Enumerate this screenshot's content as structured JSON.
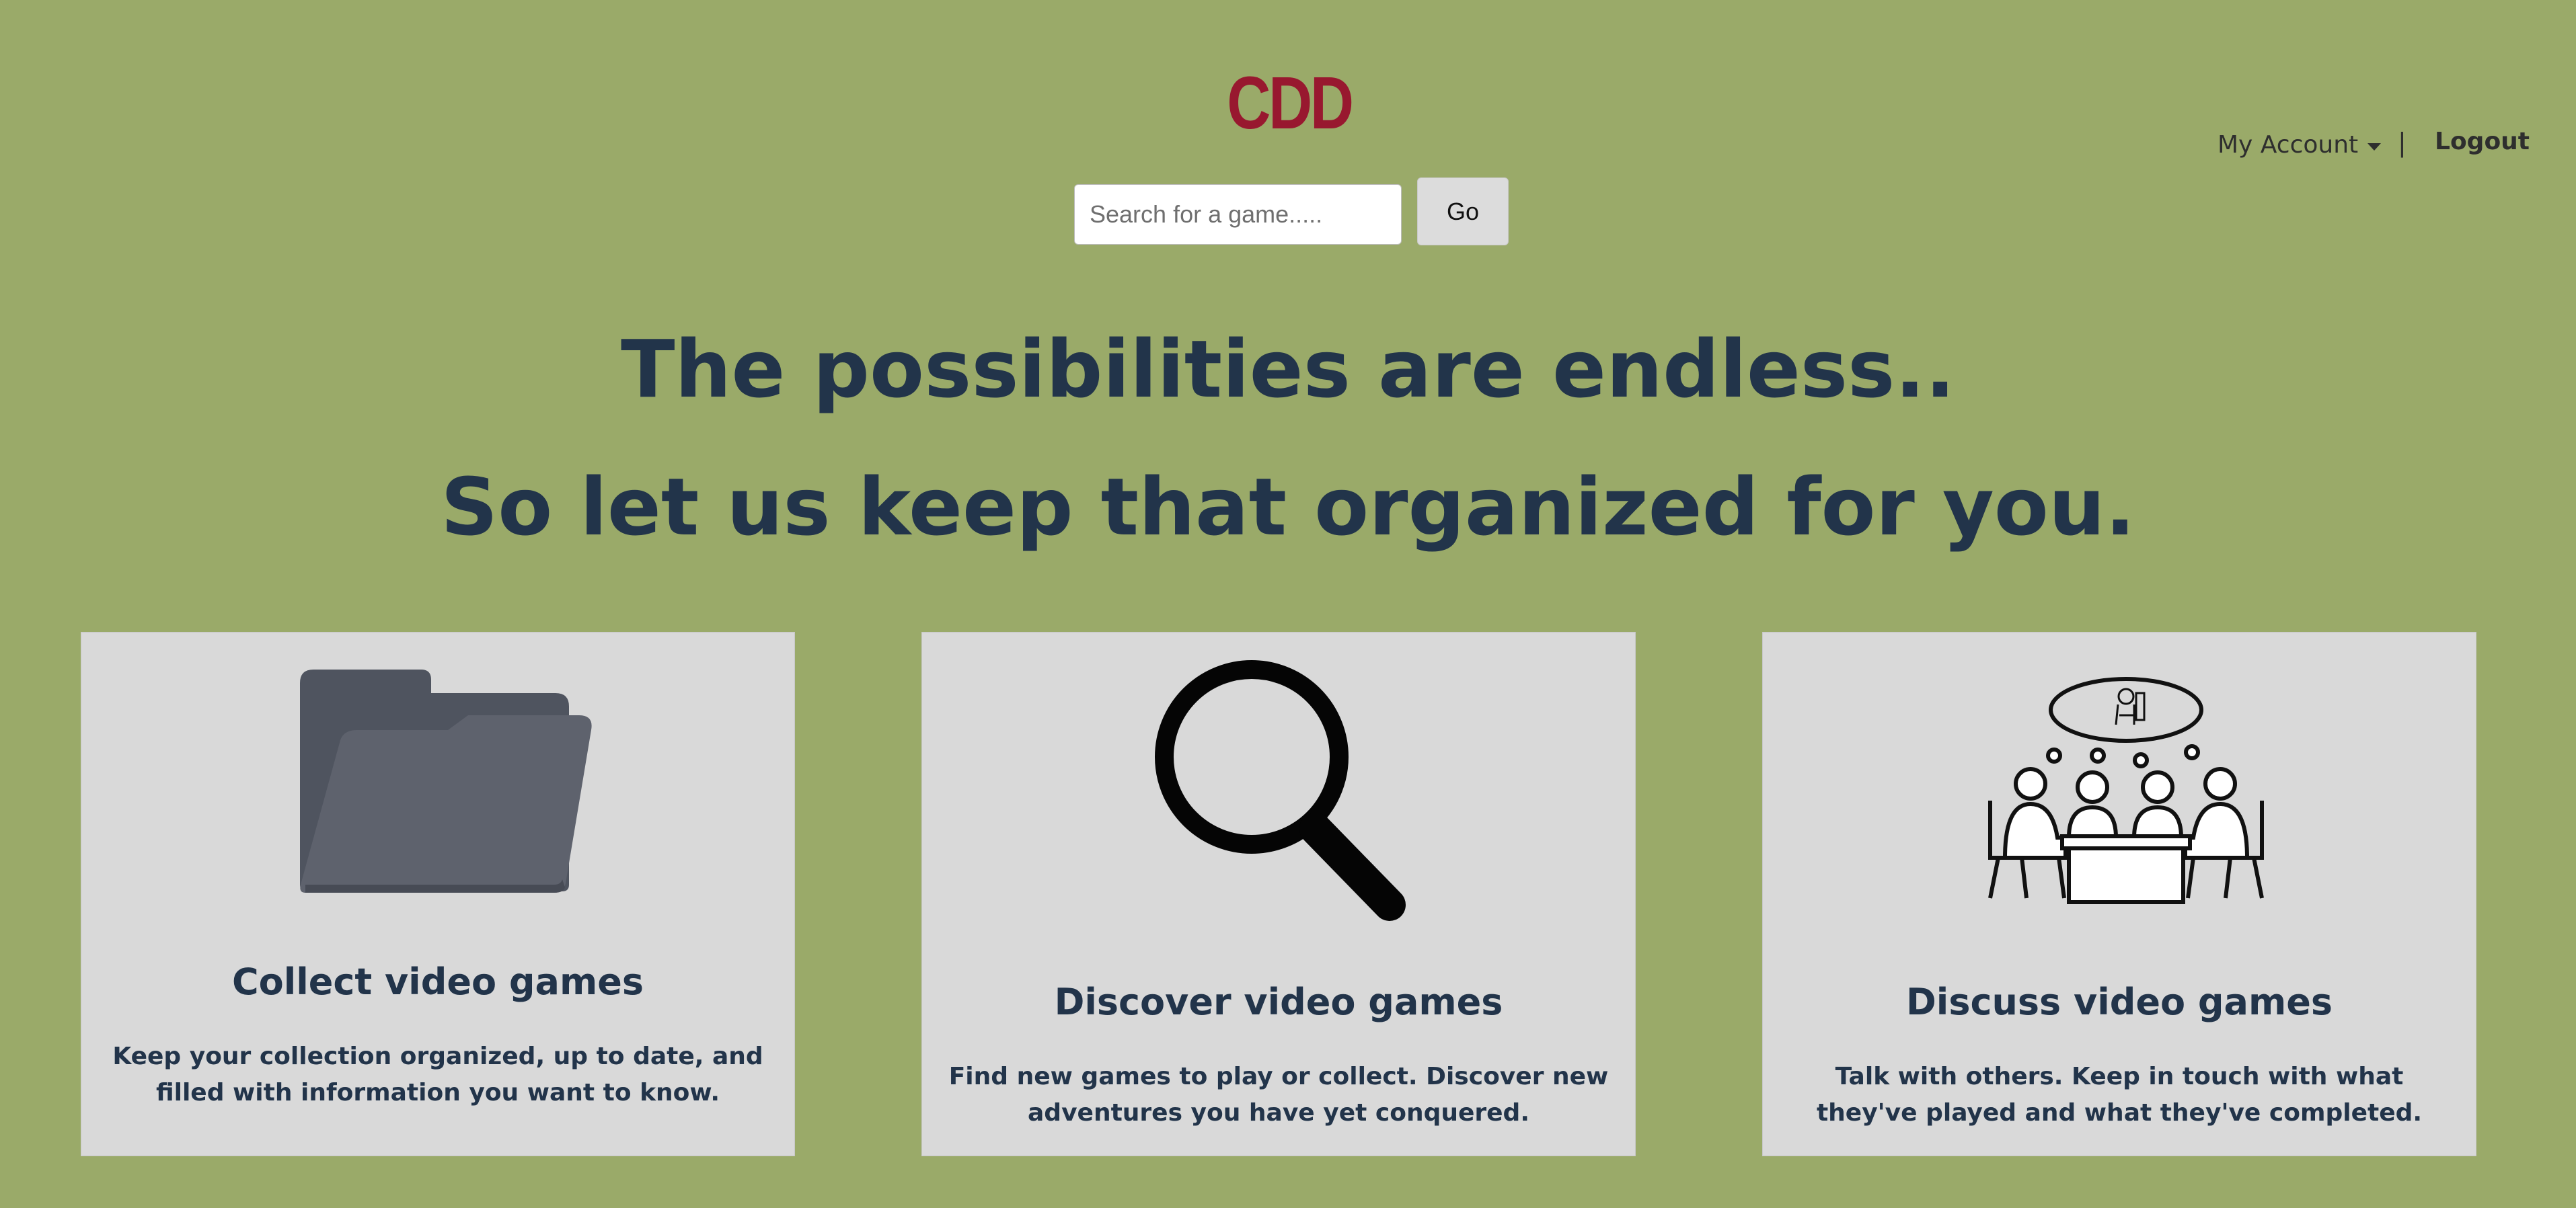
{
  "header": {
    "logo": "CDD",
    "search": {
      "placeholder": "Search for a game.....",
      "value": ""
    },
    "go_label": "Go",
    "account_label": "My Account",
    "divider": "|",
    "logout_label": "Logout"
  },
  "hero": {
    "line1": "The possibilities are endless..",
    "line2": "So let us keep that organized for you."
  },
  "features": [
    {
      "icon": "folder-icon",
      "title": "Collect video games",
      "text": "Keep your collection organized, up to date, and filled with information you want to know."
    },
    {
      "icon": "magnifier-icon",
      "title": "Discover video games",
      "text": "Find new games to play or collect. Discover new adventures you have yet conquered."
    },
    {
      "icon": "people-discussing-icon",
      "title": "Discuss video games",
      "text": "Talk with others. Keep in touch with what they've played and what they've completed."
    }
  ],
  "colors": {
    "background": "#9aaa69",
    "logo": "#98182f",
    "headline": "#22344a",
    "card": "#d9d9d9"
  }
}
